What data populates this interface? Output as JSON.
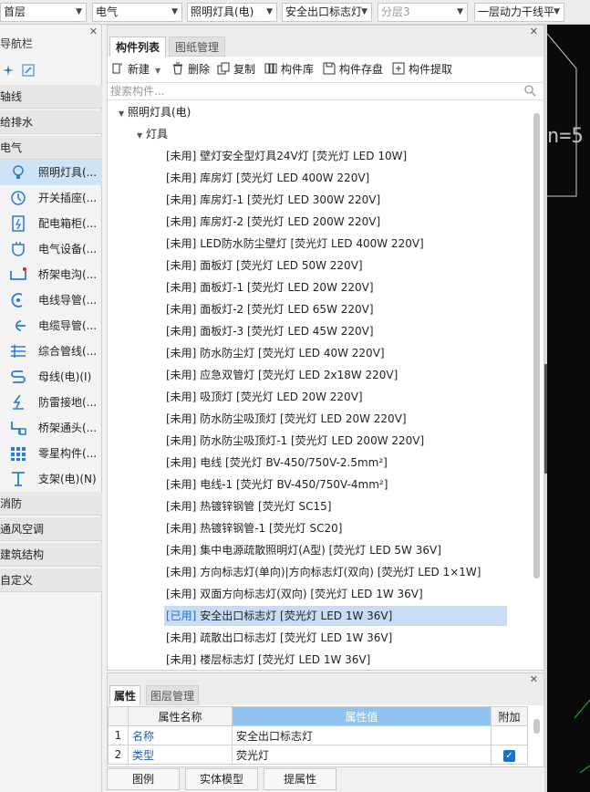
{
  "topbar": {
    "combos": [
      "首层",
      "电气",
      "照明灯具(电)",
      "安全出口标志灯",
      "分层3",
      "一层动力干线平"
    ]
  },
  "nav": {
    "title": "导航栏",
    "categories": [
      "轴线",
      "给排水",
      "电气",
      "消防",
      "通风空调",
      "建筑结构",
      "自定义"
    ],
    "items": [
      {
        "label": "照明灯具(...",
        "icon": "bulb-icon"
      },
      {
        "label": "开关插座(...",
        "icon": "switch-icon"
      },
      {
        "label": "配电箱柜(...",
        "icon": "distribution-box-icon"
      },
      {
        "label": "电气设备(...",
        "icon": "electrical-device-icon"
      },
      {
        "label": "桥架电沟(...",
        "icon": "cable-tray-icon"
      },
      {
        "label": "电线导管(...",
        "icon": "wire-conduit-icon"
      },
      {
        "label": "电缆导管(...",
        "icon": "cable-conduit-icon"
      },
      {
        "label": "综合管线(...",
        "icon": "pipeline-icon"
      },
      {
        "label": "母线(电)(I)",
        "icon": "busbar-icon"
      },
      {
        "label": "防雷接地(...",
        "icon": "lightning-ground-icon"
      },
      {
        "label": "桥架通头(...",
        "icon": "tray-fitting-icon"
      },
      {
        "label": "零星构件(...",
        "icon": "grid-components-icon"
      },
      {
        "label": "支架(电)(N)",
        "icon": "bracket-icon"
      }
    ]
  },
  "components": {
    "tabs": [
      "构件列表",
      "图纸管理"
    ],
    "toolbar": [
      "新建",
      "删除",
      "复制",
      "构件库",
      "构件存盘",
      "构件提取"
    ],
    "search_placeholder": "搜索构件...",
    "tree_root": "照明灯具(电)",
    "tree_group": "灯具",
    "items": [
      {
        "status": "[未用]",
        "text": "壁灯安全型灯具24V灯 [荧光灯 LED 10W]"
      },
      {
        "status": "[未用]",
        "text": "库房灯 [荧光灯 LED 400W  220V]"
      },
      {
        "status": "[未用]",
        "text": "库房灯-1 [荧光灯 LED 300W  220V]"
      },
      {
        "status": "[未用]",
        "text": "库房灯-2 [荧光灯 LED 200W  220V]"
      },
      {
        "status": "[未用]",
        "text": "LED防水防尘壁灯 [荧光灯 LED 400W  220V]"
      },
      {
        "status": "[未用]",
        "text": "面板灯 [荧光灯 LED 50W  220V]"
      },
      {
        "status": "[未用]",
        "text": "面板灯-1 [荧光灯 LED 20W  220V]"
      },
      {
        "status": "[未用]",
        "text": "面板灯-2 [荧光灯 LED 65W  220V]"
      },
      {
        "status": "[未用]",
        "text": "面板灯-3 [荧光灯 LED 45W  220V]"
      },
      {
        "status": "[未用]",
        "text": "防水防尘灯 [荧光灯 LED 40W  220V]"
      },
      {
        "status": "[未用]",
        "text": "应急双管灯 [荧光灯 LED 2x18W  220V]"
      },
      {
        "status": "[未用]",
        "text": "吸顶灯 [荧光灯 LED 20W  220V]"
      },
      {
        "status": "[未用]",
        "text": "防水防尘吸顶灯 [荧光灯 LED 20W  220V]"
      },
      {
        "status": "[未用]",
        "text": "防水防尘吸顶灯-1 [荧光灯 LED 200W  220V]"
      },
      {
        "status": "[未用]",
        "text": "电线 [荧光灯 BV-450/750V-2.5mm²]"
      },
      {
        "status": "[未用]",
        "text": "电线-1 [荧光灯 BV-450/750V-4mm²]"
      },
      {
        "status": "[未用]",
        "text": "热镀锌钢管 [荧光灯 SC15]"
      },
      {
        "status": "[未用]",
        "text": "热镀锌钢管-1 [荧光灯 SC20]"
      },
      {
        "status": "[未用]",
        "text": "集中电源疏散照明灯(A型) [荧光灯 LED 5W  36V]"
      },
      {
        "status": "[未用]",
        "text": "方向标志灯(单向)|方向标志灯(双向) [荧光灯 LED 1×1W]"
      },
      {
        "status": "[未用]",
        "text": "双面方向标志灯(双向) [荧光灯 LED 1W  36V]"
      },
      {
        "status": "[已用]",
        "text": "安全出口标志灯 [荧光灯 LED 1W  36V]"
      },
      {
        "status": "[未用]",
        "text": "疏散出口标志灯 [荧光灯 LED 1W  36V]"
      },
      {
        "status": "[未用]",
        "text": "楼层标志灯 [荧光灯 LED 1W  36V]"
      }
    ]
  },
  "properties": {
    "tabs": [
      "属性",
      "图层管理"
    ],
    "headers": [
      "属性名称",
      "属性值",
      "附加"
    ],
    "rows": [
      {
        "idx": "1",
        "name": "名称",
        "value": "安全出口标志灯",
        "checked": false
      },
      {
        "idx": "2",
        "name": "类型",
        "value": "荧光灯",
        "checked": true
      }
    ]
  },
  "bottom_buttons": [
    "图例",
    "实体模型",
    "提属性"
  ],
  "canvas": {
    "text": "n=5"
  },
  "colors": {
    "selection": "#c8dcf3",
    "header_blue": "#8fc4f2",
    "link_blue": "#1a5fb4",
    "used_tag": "#1a73c9"
  }
}
